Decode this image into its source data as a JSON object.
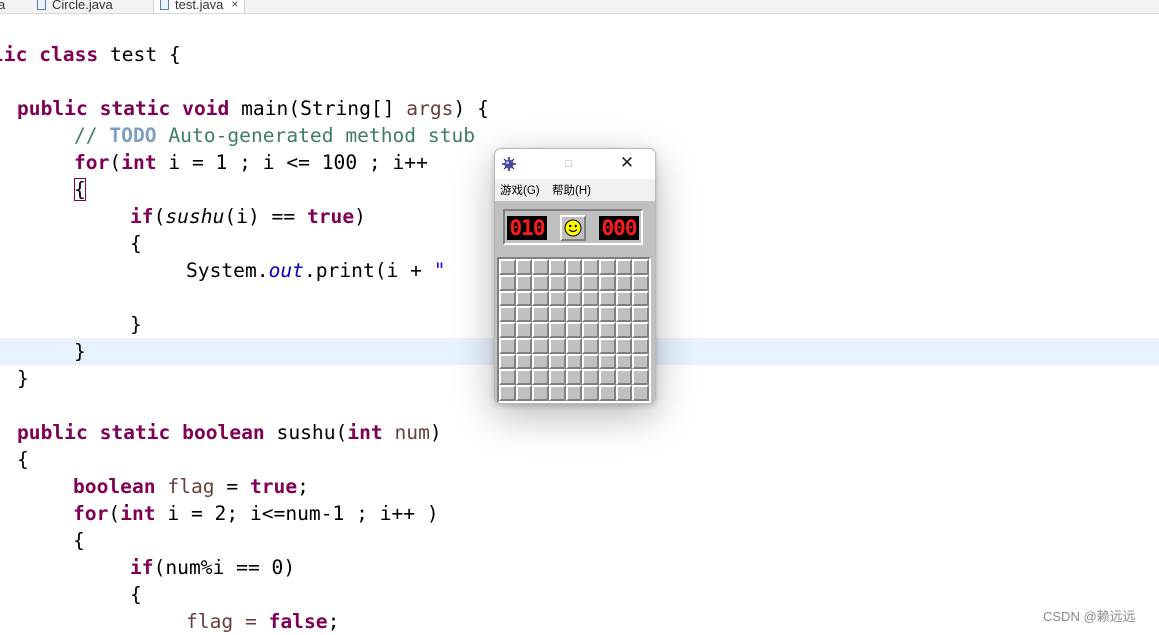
{
  "tabs": [
    {
      "label": "a",
      "active": false
    },
    {
      "label": "Circle.java",
      "active": false
    },
    {
      "label": "test.java",
      "active": true,
      "close": "×"
    }
  ],
  "code": {
    "l1": {
      "k1": "lic",
      "k2": "class",
      "t": " test {"
    },
    "l2": {
      "k1": "public",
      "k2": "static",
      "k3": "void",
      "t1": " main(String[] ",
      "v": "args",
      "t2": ") {"
    },
    "l3": {
      "c1": "// ",
      "todo": "TODO",
      "c2": " Auto-generated method stub"
    },
    "l4": {
      "k1": "for",
      "t1": "(",
      "k2": "int",
      "t2": " i = 1 ; i <= 100 ; i++"
    },
    "l5": {
      "b": "{"
    },
    "l6": {
      "k1": "if",
      "t1": "(",
      "i": "sushu",
      "t2": "(i) == ",
      "k2": "true",
      "t3": ")"
    },
    "l7": {
      "t": "{"
    },
    "l8": {
      "t1": "System.",
      "f": "out",
      "t2": ".print(i + ",
      "s": "\""
    },
    "l9": {
      "t": "}"
    },
    "l10": {
      "t": "}"
    },
    "l11": {
      "t": "}"
    },
    "l12": {
      "k1": "public",
      "k2": "static",
      "k3": "boolean",
      "t1": " sushu(",
      "k4": "int",
      "v": "num",
      "t2": ")"
    },
    "l13": {
      "t": "{"
    },
    "l14": {
      "k1": "boolean",
      "v": "flag",
      "t1": " = ",
      "k2": "true",
      "t2": ";"
    },
    "l15": {
      "k1": "for",
      "t1": "(",
      "k2": "int",
      "t2": " i = 2; i<=num-1 ; i++ )"
    },
    "l16": {
      "t": "{"
    },
    "l17": {
      "k1": "if",
      "t1": "(num%i == 0)"
    },
    "l18": {
      "t": "{"
    },
    "l19": {
      "t1": "flag = ",
      "k1": "false",
      "t2": ";"
    }
  },
  "minesweeper": {
    "max_glyph": "□",
    "close_glyph": "✕",
    "menu_game": "游戏(G)",
    "menu_help": "帮助(H)",
    "mine_counter": "010",
    "timer": "000",
    "smiley_icon": "smiley-face-icon",
    "app_icon": "mine-icon",
    "rows": 9,
    "cols": 9,
    "colors": {
      "panel": "#c0c0c0",
      "lcd": "#ff1a1a",
      "face": "#ffff00"
    }
  },
  "watermark": "CSDN @赖远远"
}
